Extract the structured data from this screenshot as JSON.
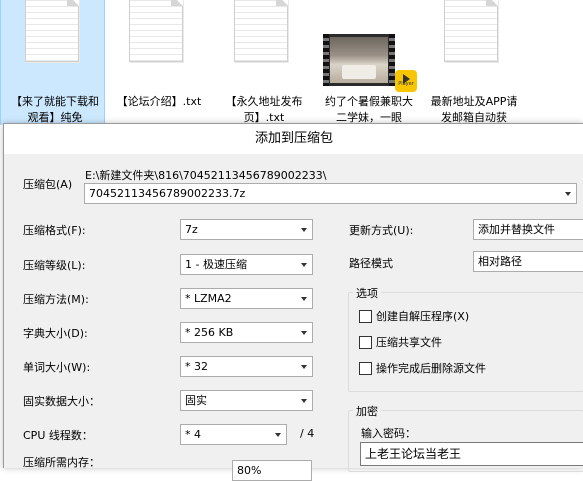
{
  "explorer": {
    "files": [
      {
        "name": "【来了就能下载和观看】纯免",
        "type": "txt",
        "selected": true
      },
      {
        "name": "【论坛介绍】.txt",
        "type": "txt",
        "selected": false
      },
      {
        "name": "【永久地址发布页】.txt",
        "type": "txt",
        "selected": false
      },
      {
        "name": "约了个暑假兼职大二学妹，一眼",
        "type": "video",
        "selected": false,
        "badge": "Player"
      },
      {
        "name": "最新地址及APP请发邮箱自动获",
        "type": "txt",
        "selected": false
      }
    ]
  },
  "dialog": {
    "title": "添加到压缩包",
    "archive": {
      "label": "压缩包(A)",
      "path": "E:\\新建文件夹\\816\\70452113456789002233\\",
      "filename": "70452113456789002233.7z"
    },
    "left": {
      "format_label": "压缩格式(F):",
      "format_value": "7z",
      "level_label": "压缩等级(L):",
      "level_value": "1 - 极速压缩",
      "method_label": "压缩方法(M):",
      "method_value": "* LZMA2",
      "dict_label": "字典大小(D):",
      "dict_value": "* 256 KB",
      "word_label": "单词大小(W):",
      "word_value": "* 32",
      "solid_label": "固实数据大小：",
      "solid_value": "固实",
      "cpu_label": "CPU 线程数：",
      "cpu_value": "* 4",
      "cpu_total": "/ 4",
      "mem_label": "压缩所需内存：",
      "mem_partial": "80%"
    },
    "right": {
      "update_label": "更新方式(U):",
      "update_value": "添加并替换文件",
      "pathmode_label": "路径模式",
      "pathmode_value": "相对路径",
      "options_title": "选项",
      "options": [
        {
          "label": "创建自解压程序(X)",
          "checked": false
        },
        {
          "label": "压缩共享文件",
          "checked": false
        },
        {
          "label": "操作完成后删除源文件",
          "checked": false
        }
      ],
      "encrypt_title": "加密",
      "password_label": "输入密码：",
      "password_value": "上老王论坛当老王"
    }
  },
  "colors": {
    "selection_bg": "#cce8ff",
    "dialog_bg": "#f0f0f0",
    "player_badge": "#f7c600"
  }
}
